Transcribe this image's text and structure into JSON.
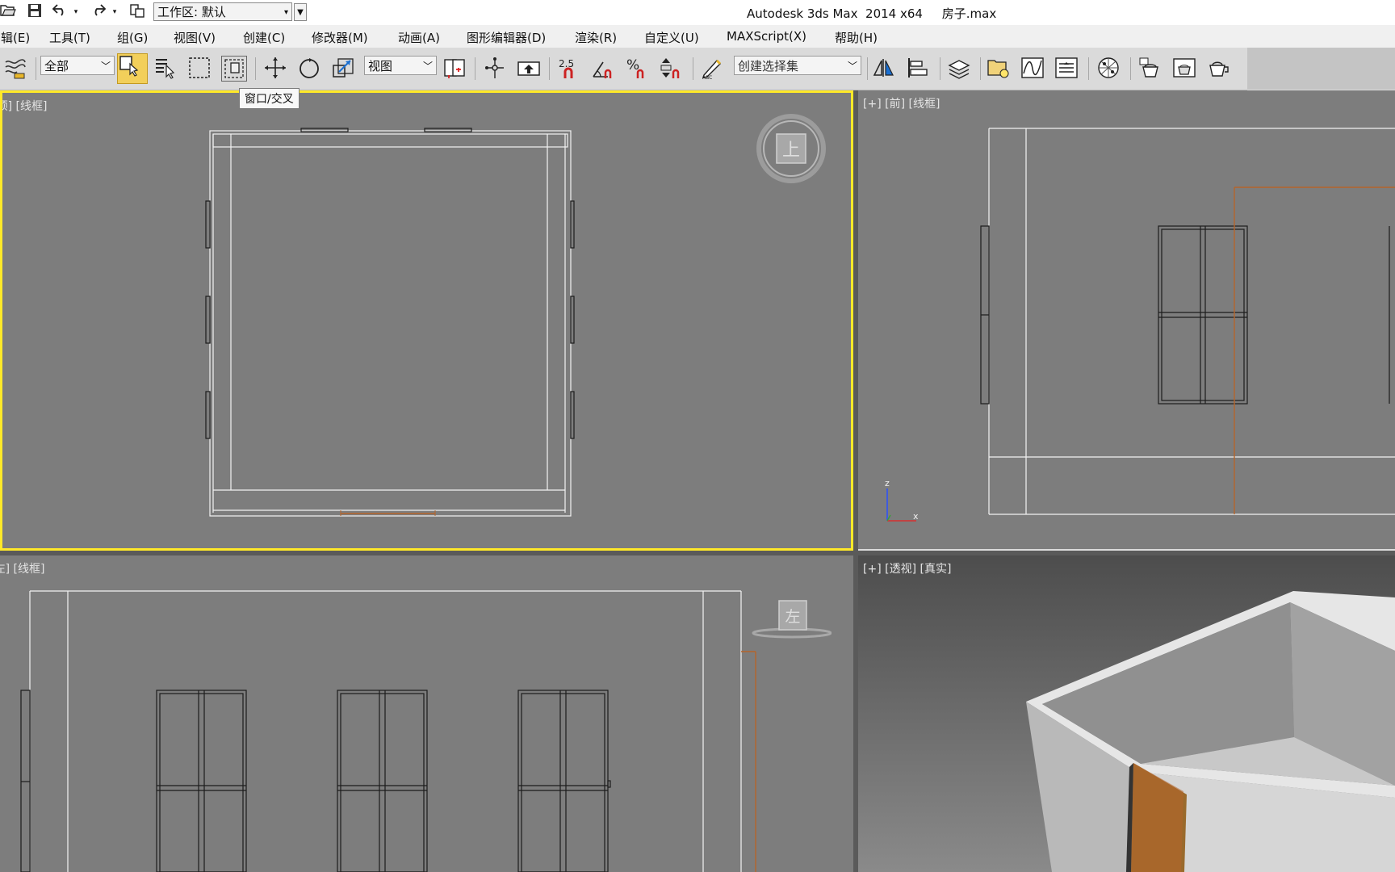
{
  "title_bar": {
    "workspace_label": "工作区: 默认",
    "app_title": "Autodesk 3ds Max  2014 x64     房子.max"
  },
  "menu": {
    "items": [
      "编辑(E)",
      "工具(T)",
      "组(G)",
      "视图(V)",
      "创建(C)",
      "修改器(M)",
      "动画(A)",
      "图形编辑器(D)",
      "渲染(R)",
      "自定义(U)",
      "MAXScript(X)",
      "帮助(H)"
    ]
  },
  "toolbar": {
    "selection_filter": "全部",
    "reference_coord": "视图",
    "named_selection_placeholder": "创建选择集",
    "snap_value": "2.5",
    "tooltip": "窗口/交叉"
  },
  "viewports": {
    "top": {
      "label": "[+] [顶] [线框]",
      "viewcube_face": "上"
    },
    "front": {
      "label": "[+] [前] [线框]",
      "axis_z": "z",
      "axis_x": "x"
    },
    "left": {
      "label": "[+] [左] [线框]",
      "viewcube_face": "左"
    },
    "perspective": {
      "label": "[+] [透视] [真实]"
    }
  },
  "colors": {
    "active_viewport_border": "#ffe928",
    "viewport_bg": "#7d7d7d",
    "wireframe": "#ffffff",
    "door_orange": "#b5652b",
    "toolbar_active": "#f2cf5a"
  }
}
